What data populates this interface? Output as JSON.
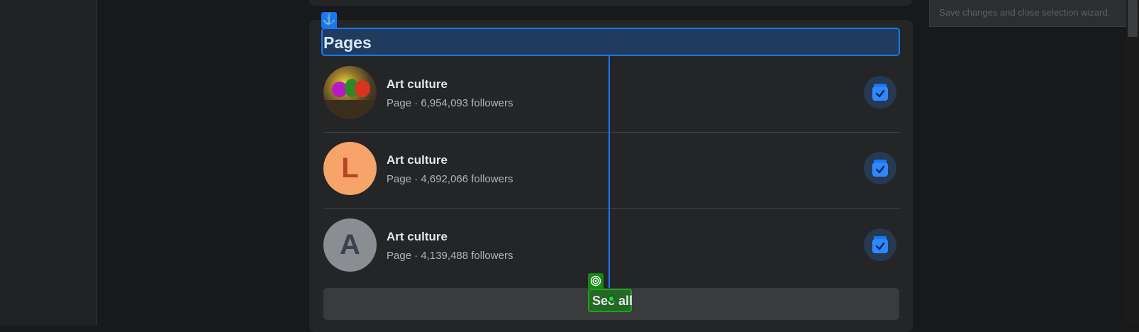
{
  "wizard_tip": "Save changes and close selection wizard.",
  "section": {
    "title": "Pages",
    "see_all_label": "See all"
  },
  "pages": [
    {
      "name": "Art culture",
      "meta": "Page · 6,954,093 followers",
      "avatar": "image"
    },
    {
      "name": "Art culture",
      "meta": "Page · 4,692,066 followers",
      "avatar_letter": "L",
      "avatar_color": "#f7a46a"
    },
    {
      "name": "Art culture",
      "meta": "Page · 4,139,488 followers",
      "avatar_letter": "A",
      "avatar_color": "#8a8d91"
    }
  ],
  "icons": {
    "anchor": "anchor-icon",
    "target": "target-icon",
    "action": "calendar-check-icon"
  },
  "colors": {
    "accent": "#1877f2",
    "target": "#1ea31e",
    "card": "#242526"
  }
}
